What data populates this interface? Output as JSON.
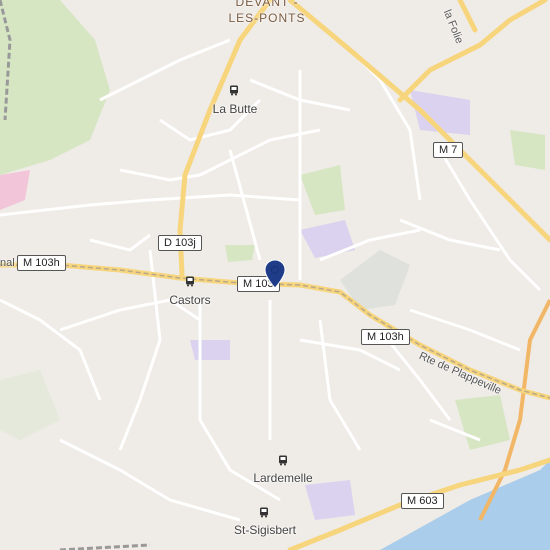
{
  "map": {
    "districts": {
      "devant_les_ponts_line1": "DEVANT -",
      "devant_les_ponts_line2": "LES-PONTS"
    },
    "places": {
      "la_butte": "La Butte",
      "castors": "Castors",
      "lardemelle": "Lardemelle",
      "st_sigisbert": "St-Sigisbert"
    },
    "road_shields": {
      "m7": "M 7",
      "d103j": "D 103j",
      "m103h_left": "M 103h",
      "m103_center": "M 103",
      "m103h_right": "M 103h",
      "m603": "M 603"
    },
    "road_names": {
      "rte_de_plappeville": "Rte de Plappeville",
      "la_folie": "la Folie",
      "nal": "nal"
    },
    "icons": {
      "bus_stop": "bus-stop-icon",
      "location_marker": "location-pin-icon"
    },
    "colors": {
      "background": "#efebe6",
      "major_road": "#f7d57c",
      "minor_road": "#ffffff",
      "green": "#d6e6c3",
      "river": "#a9cdea",
      "purple": "#dad2ef",
      "marker": "#1f3c88"
    }
  }
}
